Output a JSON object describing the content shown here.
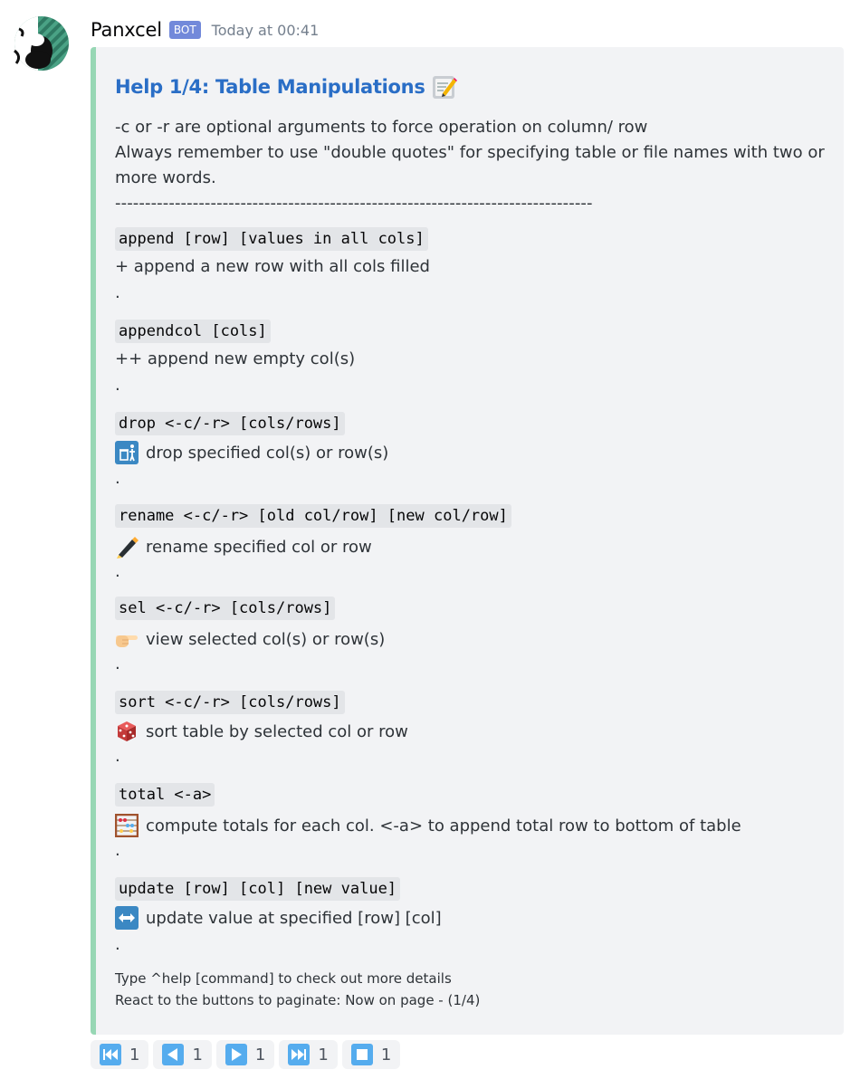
{
  "message": {
    "username": "Panxcel",
    "bot_tag": "BOT",
    "timestamp": "Today at 00:41"
  },
  "embed": {
    "title": "Help 1/4: Table Manipulations",
    "title_icon": "memo-icon",
    "accent_color": "#97d7b4",
    "description": [
      "-c or -r are optional arguments to force operation on column/ row",
      "Always remember to use \"double quotes\" for specifying table or file names with two or more words.",
      "--------------------------------------------------------------------------------"
    ],
    "commands": [
      {
        "syntax": "append [row] [values in all cols]",
        "icon": "none",
        "desc": "+ append a new row with all cols filled",
        "sep": "."
      },
      {
        "syntax": "appendcol [cols]",
        "icon": "none",
        "desc": "++ append new empty col(s)",
        "sep": "."
      },
      {
        "syntax": "drop <-c/-r> [cols/rows]",
        "icon": "wastebasket-icon",
        "desc": "drop specified col(s) or row(s)",
        "sep": "."
      },
      {
        "syntax": "rename <-c/-r> [old col/row] [new col/row]",
        "icon": "pen-icon",
        "desc": "rename specified col or row",
        "sep": "."
      },
      {
        "syntax": "sel <-c/-r> [cols/rows]",
        "icon": "pointing-hand-icon",
        "desc": "view selected col(s) or row(s)",
        "sep": "."
      },
      {
        "syntax": "sort <-c/-r> [cols/rows]",
        "icon": "dice-icon",
        "desc": "sort table by selected col or row",
        "sep": "."
      },
      {
        "syntax": "total <-a> ",
        "icon": "abacus-icon",
        "desc": "compute totals for each col. <-a> to append total row to bottom of table",
        "sep": "."
      },
      {
        "syntax": "update [row] [col] [new value]",
        "icon": "left-right-arrow-icon",
        "desc": "update value at specified [row] [col]",
        "sep": "."
      }
    ],
    "footer": [
      "Type ^help [command] to check out more details",
      "React to the buttons to paginate: Now on page - (1/4)"
    ]
  },
  "reactions": [
    {
      "icon": "first-page-icon",
      "count": "1"
    },
    {
      "icon": "previous-page-icon",
      "count": "1"
    },
    {
      "icon": "next-page-icon",
      "count": "1"
    },
    {
      "icon": "last-page-icon",
      "count": "1"
    },
    {
      "icon": "stop-icon",
      "count": "1"
    }
  ]
}
